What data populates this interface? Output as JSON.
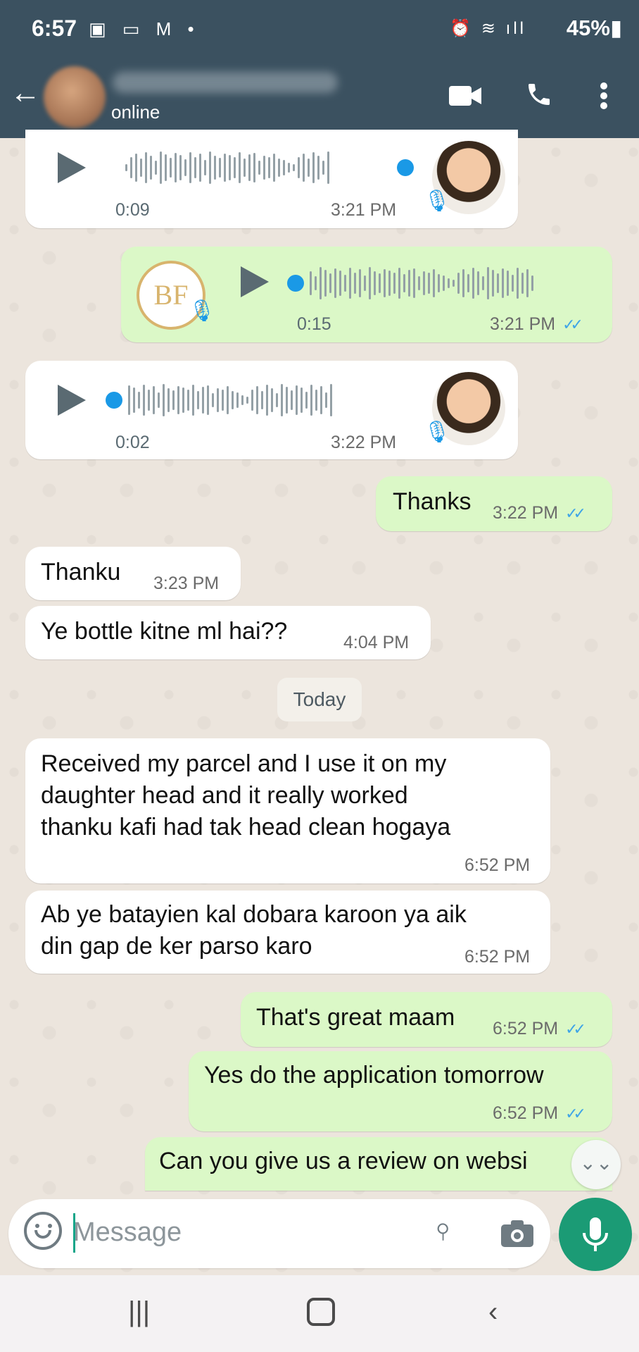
{
  "status_bar": {
    "time": "6:57",
    "battery": "45%"
  },
  "header": {
    "contact_status": "online"
  },
  "messages": [
    {
      "duration": "0:09",
      "time": "3:21 PM"
    },
    {
      "duration": "0:15",
      "time": "3:21 PM"
    },
    {
      "duration": "0:02",
      "time": "3:22 PM"
    },
    {
      "text": "Thanks",
      "time": "3:22 PM"
    },
    {
      "text": "Thanku",
      "time": "3:23 PM"
    },
    {
      "text": "Ye bottle kitne ml hai??",
      "time": "4:04 PM"
    },
    {
      "text_lines": [
        "Received my parcel and I use it on my",
        "daughter head and it really worked",
        "thanku kafi had tak head clean hogaya"
      ],
      "time": "6:52 PM"
    },
    {
      "text_lines": [
        "Ab ye batayien kal dobara karoon ya aik",
        "din gap de ker parso karo"
      ],
      "time": "6:52 PM"
    },
    {
      "text": "That's great maam",
      "time": "6:52 PM"
    },
    {
      "text": "Yes do the application tomorrow",
      "time": "6:52 PM"
    },
    {
      "text": "Can you give us a review on websi"
    }
  ],
  "date_divider": "Today",
  "input": {
    "placeholder": "Message"
  },
  "icons": {
    "back": "arrow-left",
    "video": "video-camera",
    "call": "phone",
    "menu": "more-vertical",
    "play": "play",
    "mic": "microphone",
    "emoji": "smiley",
    "attach": "paperclip",
    "camera": "camera",
    "scroll_down": "double-chevron-down",
    "read": "double-check"
  },
  "colors": {
    "header": "#3b5160",
    "outgoing": "#dbf8c7",
    "incoming": "#ffffff",
    "accent": "#1b9b75",
    "ticks": "#3ea4e7"
  }
}
